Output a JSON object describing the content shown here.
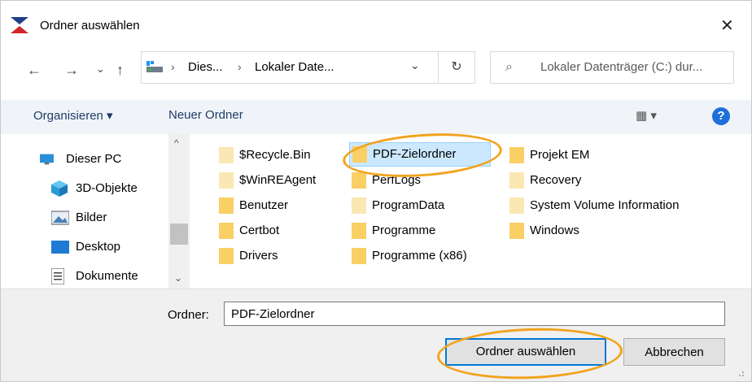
{
  "window": {
    "title": "Ordner auswählen",
    "close_glyph": "✕"
  },
  "nav": {
    "back_glyph": "←",
    "forward_glyph": "→",
    "recent_glyph": "⌄",
    "up_glyph": "↑",
    "address": {
      "crumbs": [
        "Dies...",
        "Lokaler Date..."
      ],
      "separator": "›",
      "dropdown_glyph": "⌄"
    },
    "refresh_glyph": "↻",
    "search": {
      "placeholder": "Lokaler Datenträger (C:) dur...",
      "icon": "search-icon"
    }
  },
  "toolbar": {
    "organize_label": "Organisieren ▾",
    "new_folder_label": "Neuer Ordner",
    "view_glyph": "▦ ▾",
    "help_glyph": "?"
  },
  "sidebar": {
    "items": [
      {
        "label": "Dieser PC",
        "icon": "pc-icon"
      },
      {
        "label": "3D-Objekte",
        "icon": "cube-icon"
      },
      {
        "label": "Bilder",
        "icon": "pictures-icon"
      },
      {
        "label": "Desktop",
        "icon": "desktop-icon"
      },
      {
        "label": "Dokumente",
        "icon": "documents-icon"
      }
    ],
    "scroll_up_glyph": "^",
    "scroll_down_glyph": "⌄"
  },
  "files": {
    "col1": [
      "$Recycle.Bin",
      "$WinREAgent",
      "Benutzer",
      "Certbot",
      "Drivers"
    ],
    "col2": [
      "PDF-Zielordner",
      "PerfLogs",
      "ProgramData",
      "Programme",
      "Programme (x86)"
    ],
    "col3": [
      "Projekt EM",
      "Recovery",
      "System Volume Information",
      "Windows"
    ],
    "selected": "PDF-Zielordner"
  },
  "bottom": {
    "folder_label": "Ordner:",
    "folder_value": "PDF-Zielordner",
    "select_button": "Ordner auswählen",
    "cancel_button": "Abbrechen"
  },
  "colors": {
    "accent": "#0078d7",
    "selection": "#cce8ff",
    "annotation": "#f2a31e",
    "folder": "#f9cf66",
    "folder_faded": "#fbe7b2"
  }
}
